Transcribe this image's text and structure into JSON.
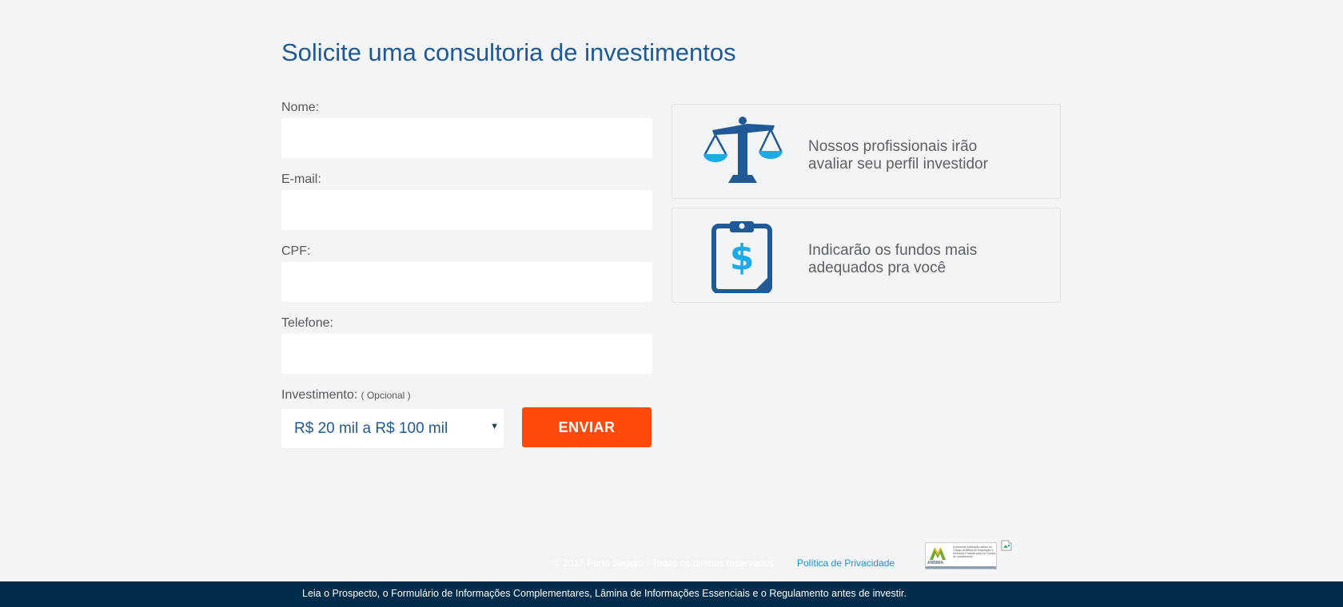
{
  "form": {
    "title": "Solicite uma consultoria de investimentos",
    "fields": [
      {
        "label": "Nome:",
        "value": "",
        "placeholder": ""
      },
      {
        "label": "E-mail:",
        "value": "",
        "placeholder": ""
      },
      {
        "label": "CPF:",
        "value": "",
        "placeholder": ""
      },
      {
        "label": "Telefone:",
        "value": "",
        "placeholder": ""
      }
    ],
    "investment": {
      "label": "Investimento:",
      "optional_note": "( Opcional )",
      "selected": "R$ 20 mil a R$ 100 mil"
    },
    "submit_label": "ENVIAR"
  },
  "features": [
    {
      "icon": "balance-scale-icon",
      "text": "Nossos profissionais irão avaliar seu perfil investidor"
    },
    {
      "icon": "clipboard-dollar-icon",
      "text": "Indicarão os fundos mais adequados pra você"
    }
  ],
  "footer": {
    "copyright": "© 2017 Porto Seguro - Todos os direitos reservados.",
    "privacy_link": "Política de Privacidade",
    "anbima_logo": "ANBIMA",
    "anbima_text": "A presente instituição aderiu ao Código ANBIMA de Regulação e Melhores Práticas para os Fundos de Investimento.",
    "disclaimer": "Leia o Prospecto, o Formulário de Informações Complementares, Lâmina de Informações Essenciais e o Regulamento antes de investir."
  },
  "colors": {
    "background": "#f3f4f6",
    "title": "#1f5a96",
    "accent_button": "#ff4a0e",
    "icon_dark": "#1f5a96",
    "icon_light": "#1eaae6",
    "link": "#1b8fd0",
    "bottom_bar": "#022c4c"
  }
}
